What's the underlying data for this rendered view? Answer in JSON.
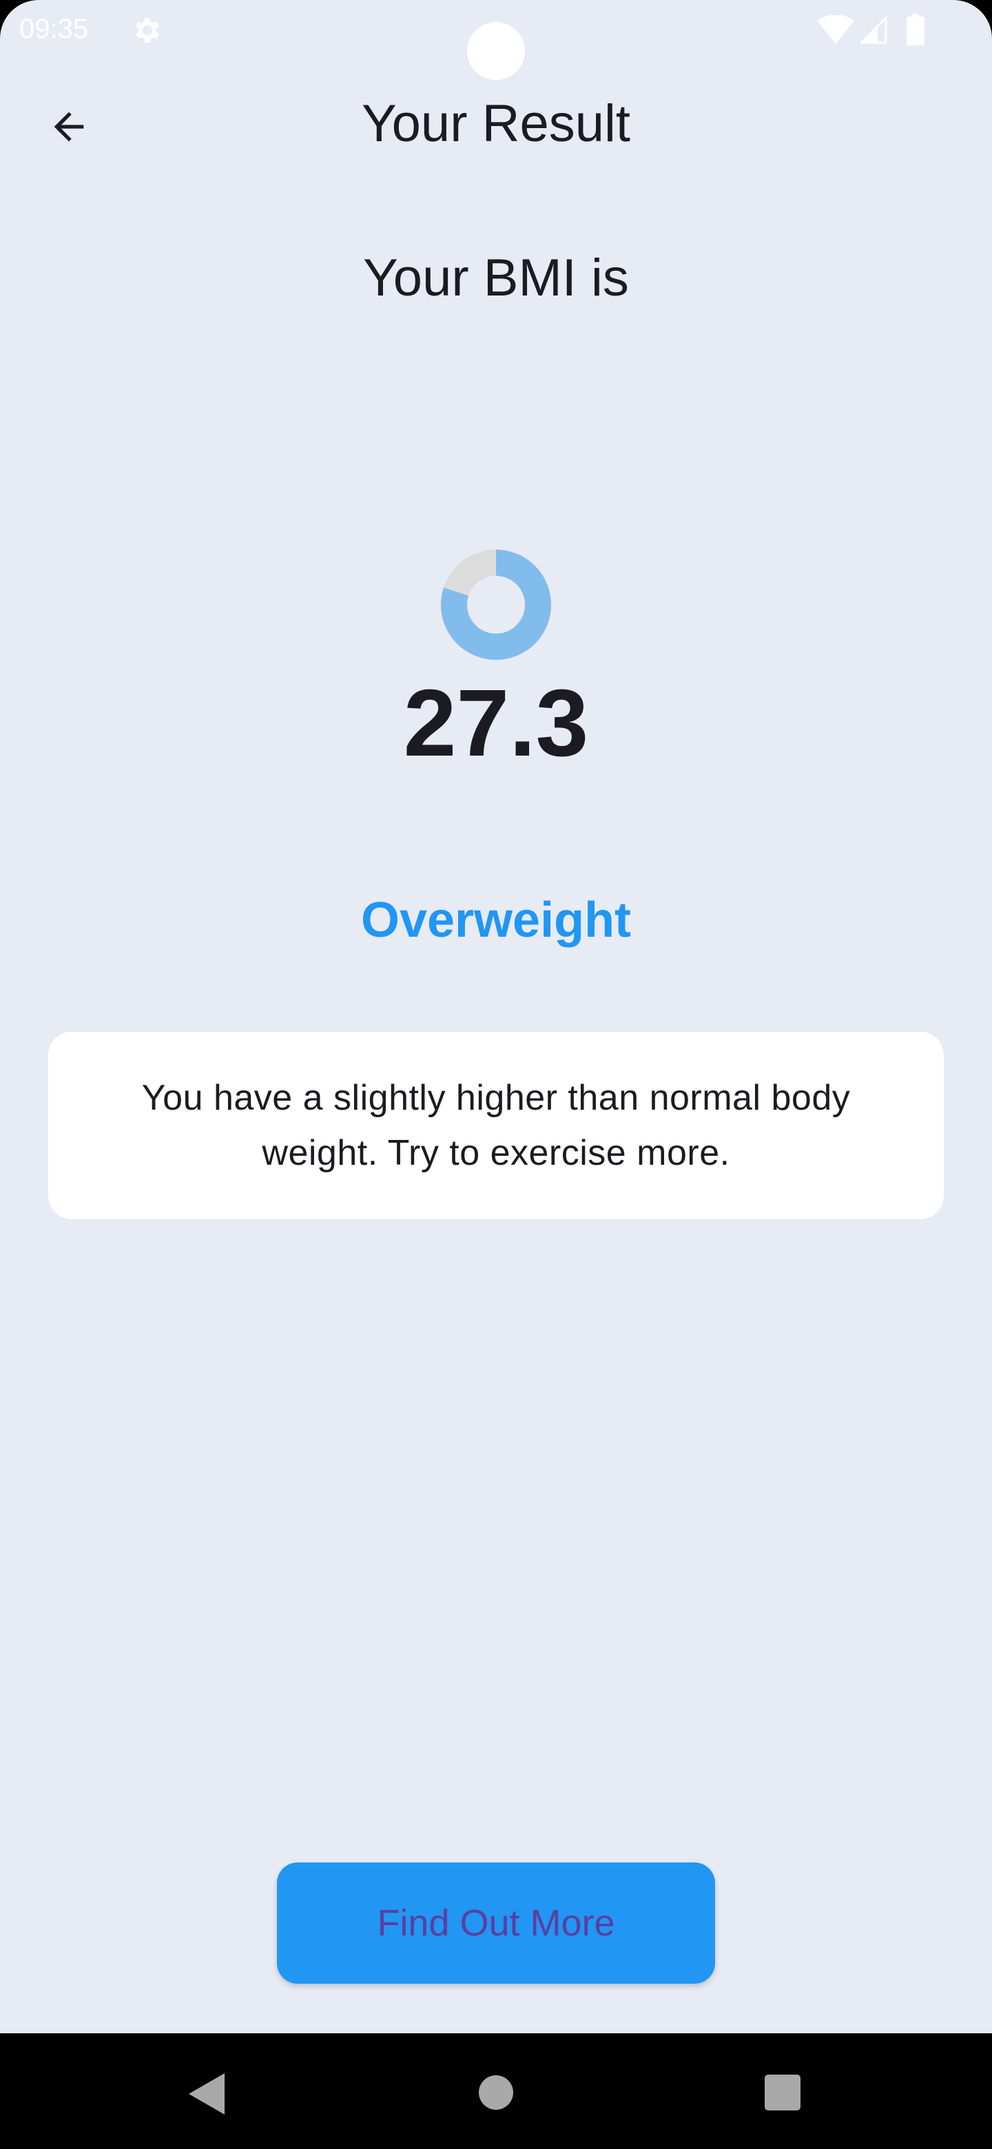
{
  "status_bar": {
    "time": "09:35",
    "icons": [
      "gear-icon",
      "wifi-icon",
      "signal-icon",
      "battery-icon"
    ]
  },
  "app_bar": {
    "back_icon": "arrow-left-icon",
    "title": "Your Result"
  },
  "result": {
    "heading": "Your BMI is",
    "bmi_value": "27.3",
    "category": "Overweight",
    "message": "You have a slightly higher than normal body weight. Try to exercise more.",
    "progress_fraction": 0.8
  },
  "actions": {
    "find_out_more_label": "Find Out More"
  },
  "nav_bar": {
    "icons": [
      "back-triangle-icon",
      "home-circle-icon",
      "recents-square-icon"
    ]
  },
  "colors": {
    "background": "#e7ebf4",
    "accent": "#2196f3",
    "progress_fill": "#82bcec",
    "progress_track": "#dcdcdc",
    "button_label": "#5a3fa0",
    "text": "#1b1b21"
  }
}
